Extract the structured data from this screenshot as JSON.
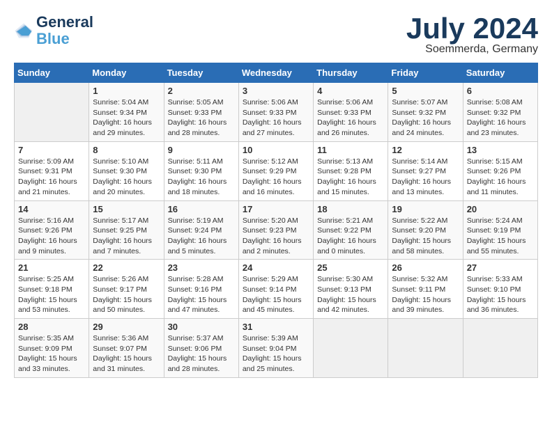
{
  "logo": {
    "line1": "General",
    "line2": "Blue"
  },
  "title": "July 2024",
  "subtitle": "Soemmerda, Germany",
  "days_header": [
    "Sunday",
    "Monday",
    "Tuesday",
    "Wednesday",
    "Thursday",
    "Friday",
    "Saturday"
  ],
  "weeks": [
    [
      {
        "day": "",
        "info": ""
      },
      {
        "day": "1",
        "info": "Sunrise: 5:04 AM\nSunset: 9:34 PM\nDaylight: 16 hours\nand 29 minutes."
      },
      {
        "day": "2",
        "info": "Sunrise: 5:05 AM\nSunset: 9:33 PM\nDaylight: 16 hours\nand 28 minutes."
      },
      {
        "day": "3",
        "info": "Sunrise: 5:06 AM\nSunset: 9:33 PM\nDaylight: 16 hours\nand 27 minutes."
      },
      {
        "day": "4",
        "info": "Sunrise: 5:06 AM\nSunset: 9:33 PM\nDaylight: 16 hours\nand 26 minutes."
      },
      {
        "day": "5",
        "info": "Sunrise: 5:07 AM\nSunset: 9:32 PM\nDaylight: 16 hours\nand 24 minutes."
      },
      {
        "day": "6",
        "info": "Sunrise: 5:08 AM\nSunset: 9:32 PM\nDaylight: 16 hours\nand 23 minutes."
      }
    ],
    [
      {
        "day": "7",
        "info": "Sunrise: 5:09 AM\nSunset: 9:31 PM\nDaylight: 16 hours\nand 21 minutes."
      },
      {
        "day": "8",
        "info": "Sunrise: 5:10 AM\nSunset: 9:30 PM\nDaylight: 16 hours\nand 20 minutes."
      },
      {
        "day": "9",
        "info": "Sunrise: 5:11 AM\nSunset: 9:30 PM\nDaylight: 16 hours\nand 18 minutes."
      },
      {
        "day": "10",
        "info": "Sunrise: 5:12 AM\nSunset: 9:29 PM\nDaylight: 16 hours\nand 16 minutes."
      },
      {
        "day": "11",
        "info": "Sunrise: 5:13 AM\nSunset: 9:28 PM\nDaylight: 16 hours\nand 15 minutes."
      },
      {
        "day": "12",
        "info": "Sunrise: 5:14 AM\nSunset: 9:27 PM\nDaylight: 16 hours\nand 13 minutes."
      },
      {
        "day": "13",
        "info": "Sunrise: 5:15 AM\nSunset: 9:26 PM\nDaylight: 16 hours\nand 11 minutes."
      }
    ],
    [
      {
        "day": "14",
        "info": "Sunrise: 5:16 AM\nSunset: 9:26 PM\nDaylight: 16 hours\nand 9 minutes."
      },
      {
        "day": "15",
        "info": "Sunrise: 5:17 AM\nSunset: 9:25 PM\nDaylight: 16 hours\nand 7 minutes."
      },
      {
        "day": "16",
        "info": "Sunrise: 5:19 AM\nSunset: 9:24 PM\nDaylight: 16 hours\nand 5 minutes."
      },
      {
        "day": "17",
        "info": "Sunrise: 5:20 AM\nSunset: 9:23 PM\nDaylight: 16 hours\nand 2 minutes."
      },
      {
        "day": "18",
        "info": "Sunrise: 5:21 AM\nSunset: 9:22 PM\nDaylight: 16 hours\nand 0 minutes."
      },
      {
        "day": "19",
        "info": "Sunrise: 5:22 AM\nSunset: 9:20 PM\nDaylight: 15 hours\nand 58 minutes."
      },
      {
        "day": "20",
        "info": "Sunrise: 5:24 AM\nSunset: 9:19 PM\nDaylight: 15 hours\nand 55 minutes."
      }
    ],
    [
      {
        "day": "21",
        "info": "Sunrise: 5:25 AM\nSunset: 9:18 PM\nDaylight: 15 hours\nand 53 minutes."
      },
      {
        "day": "22",
        "info": "Sunrise: 5:26 AM\nSunset: 9:17 PM\nDaylight: 15 hours\nand 50 minutes."
      },
      {
        "day": "23",
        "info": "Sunrise: 5:28 AM\nSunset: 9:16 PM\nDaylight: 15 hours\nand 47 minutes."
      },
      {
        "day": "24",
        "info": "Sunrise: 5:29 AM\nSunset: 9:14 PM\nDaylight: 15 hours\nand 45 minutes."
      },
      {
        "day": "25",
        "info": "Sunrise: 5:30 AM\nSunset: 9:13 PM\nDaylight: 15 hours\nand 42 minutes."
      },
      {
        "day": "26",
        "info": "Sunrise: 5:32 AM\nSunset: 9:11 PM\nDaylight: 15 hours\nand 39 minutes."
      },
      {
        "day": "27",
        "info": "Sunrise: 5:33 AM\nSunset: 9:10 PM\nDaylight: 15 hours\nand 36 minutes."
      }
    ],
    [
      {
        "day": "28",
        "info": "Sunrise: 5:35 AM\nSunset: 9:09 PM\nDaylight: 15 hours\nand 33 minutes."
      },
      {
        "day": "29",
        "info": "Sunrise: 5:36 AM\nSunset: 9:07 PM\nDaylight: 15 hours\nand 31 minutes."
      },
      {
        "day": "30",
        "info": "Sunrise: 5:37 AM\nSunset: 9:06 PM\nDaylight: 15 hours\nand 28 minutes."
      },
      {
        "day": "31",
        "info": "Sunrise: 5:39 AM\nSunset: 9:04 PM\nDaylight: 15 hours\nand 25 minutes."
      },
      {
        "day": "",
        "info": ""
      },
      {
        "day": "",
        "info": ""
      },
      {
        "day": "",
        "info": ""
      }
    ]
  ]
}
